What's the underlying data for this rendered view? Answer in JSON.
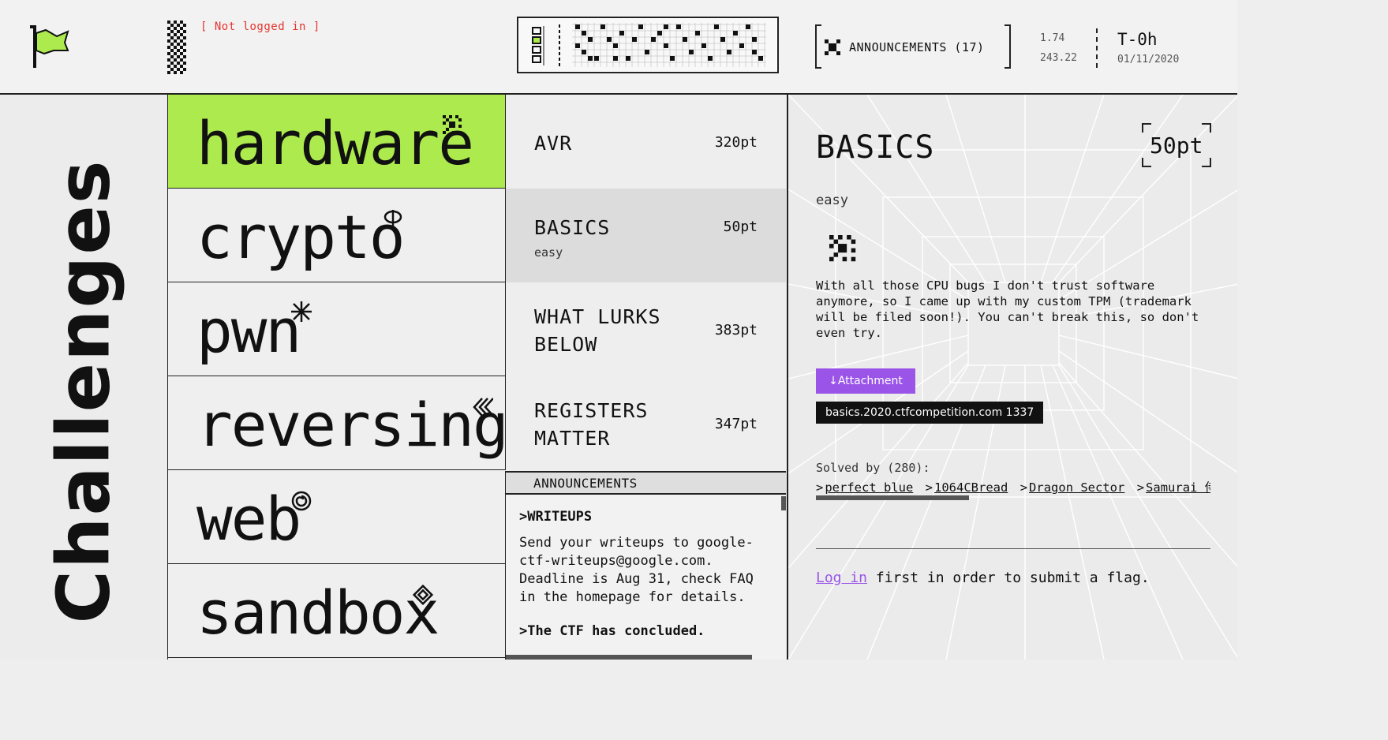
{
  "header": {
    "login_status": "[ Not logged in ]",
    "announcements_label": "ANNOUNCEMENTS (17)",
    "stat_a": "1.74",
    "stat_b": "243.22",
    "clock": "T-0h",
    "date": "01/11/2020",
    "colors": {
      "accent": "#acea4d",
      "error": "#e4342f"
    }
  },
  "side": {
    "title": "Challenges"
  },
  "categories": [
    {
      "label": "hardware",
      "icon": "hardware-icon",
      "active": true
    },
    {
      "label": "crypto",
      "icon": "crypto-icon"
    },
    {
      "label": "pwn",
      "icon": "pwn-icon"
    },
    {
      "label": "reversing",
      "icon": "reversing-icon"
    },
    {
      "label": "web",
      "icon": "web-icon"
    },
    {
      "label": "sandbox",
      "icon": "sandbox-icon"
    }
  ],
  "challenges": [
    {
      "name": "AVR",
      "points": "320pt"
    },
    {
      "name": "BASICS",
      "points": "50pt",
      "difficulty": "easy",
      "selected": true
    },
    {
      "name": "WHAT LURKS BELOW",
      "name_l1": "WHAT LURKS",
      "name_l2": "BELOW",
      "points": "383pt"
    },
    {
      "name": "REGISTERS MATTER",
      "name_l1": "REGISTERS",
      "name_l2": "MATTER",
      "points": "347pt"
    }
  ],
  "announcements": {
    "heading": "ANNOUNCEMENTS",
    "items": [
      {
        "title": "WRITEUPS",
        "body": "Send your writeups to google-ctf-writeups@google.com. Deadline is Aug 31, check FAQ in the homepage for details."
      },
      {
        "title": "The CTF has concluded."
      }
    ]
  },
  "detail": {
    "title": "BASICS",
    "points": "50pt",
    "difficulty": "easy",
    "description": "With all those CPU bugs I don't trust software anymore, so I came up with my custom TPM (trademark will be filed soon!). You can't break this, so don't even try.",
    "attachment_label": "↓Attachment",
    "connection": "basics.2020.ctfcompetition.com 1337",
    "solved_by_label": "Solved by (280):",
    "solvers": [
      "perfect blue",
      "1064CBread",
      "Dragon Sector",
      "Samurai 侍"
    ],
    "login_link": "Log in",
    "login_text": " first in order to submit a flag.",
    "colors": {
      "attachment": "#9a55e8",
      "login_link": "#9a55e8"
    }
  }
}
